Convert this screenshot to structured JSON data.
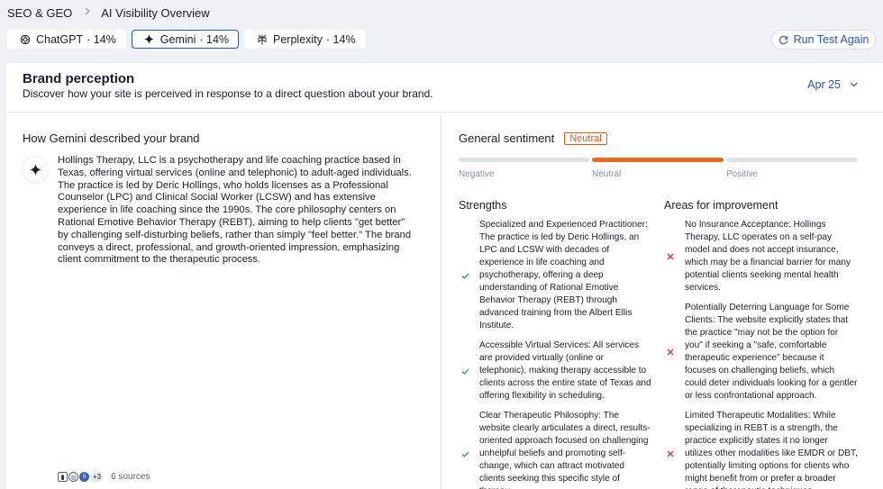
{
  "breadcrumb": {
    "root": "SEO & GEO",
    "current": "AI Visibility Overview"
  },
  "tabs": [
    {
      "label": "ChatGPT",
      "score": "· 14%",
      "icon": "openai-icon",
      "active": false
    },
    {
      "label": "Gemini",
      "score": "· 14%",
      "icon": "gemini-sparkle-icon",
      "active": true
    },
    {
      "label": "Perplexity",
      "score": "· 14%",
      "icon": "perplexity-icon",
      "active": false
    }
  ],
  "run_button": {
    "label": "Run Test Again",
    "icon": "refresh-icon"
  },
  "card": {
    "title": "Brand perception",
    "subtitle": "Discover how your site is perceived in response to a direct question about your brand.",
    "date": "Apr 25"
  },
  "description": {
    "title": "How Gemini described your brand",
    "text": "Hollings Therapy, LLC is a psychotherapy and life coaching practice based in Texas, offering virtual services (online and telephonic) to adult-aged individuals. The practice is led by Deric Hollings, who holds licenses as a Professional Counselor (LPC) and Clinical Social Worker (LCSW) and has extensive experience in life coaching since the 1990s. The core philosophy centers on Rational Emotive Behavior Therapy (REBT), aiming to help clients \"get better\" by challenging self-disturbing beliefs, rather than simply \"feel better.\" The brand conveys a direct, professional, and growth-oriented impression, emphasizing client commitment to the therapeutic process.",
    "sources_more": "+3",
    "sources_label": "6 sources"
  },
  "sentiment": {
    "title": "General sentiment",
    "badge": "Neutral",
    "level": "neutral",
    "labels": {
      "negative": "Negative",
      "neutral": "Neutral",
      "positive": "Positive"
    }
  },
  "strengths": {
    "title": "Strengths",
    "items": [
      "Specialized and Experienced Practitioner: The practice is led by Deric Hollings, an LPC and LCSW with decades of experience in life coaching and psychotherapy, offering a deep understanding of Rational Emotive Behavior Therapy (REBT) through advanced training from the Albert Ellis Institute.",
      "Accessible Virtual Services: All services are provided virtually (online or telephonic), making therapy accessible to clients across the entire state of Texas and offering flexibility in scheduling.",
      "Clear Therapeutic Philosophy: The website clearly articulates a direct, results-oriented approach focused on challenging unhelpful beliefs and promoting self-change, which can attract motivated clients seeking this specific style of therapy."
    ]
  },
  "improvements": {
    "title": "Areas for improvement",
    "items": [
      "No Insurance Acceptance: Hollings Therapy, LLC operates on a self-pay model and does not accept insurance, which may be a financial barrier for many potential clients seeking mental health services.",
      "Potentially Deterring Language for Some Clients: The website explicitly states that the practice \"may not be the option for you\" if seeking a \"safe, comfortable therapeutic experience\" because it focuses on challenging beliefs, which could deter individuals looking for a gentler or less confrontational approach.",
      "Limited Therapeutic Modalities: While specializing in REBT is a strength, the practice explicitly states it no longer utilizes other modalities like EMDR or DBT, potentially limiting options for clients who might benefit from or prefer a broader range of therapeutic techniques."
    ]
  },
  "colors": {
    "accent": "#2a56c6",
    "sentiment": "#e66a1f",
    "check": "#2e9e5b",
    "cross": "#d83a3a"
  }
}
